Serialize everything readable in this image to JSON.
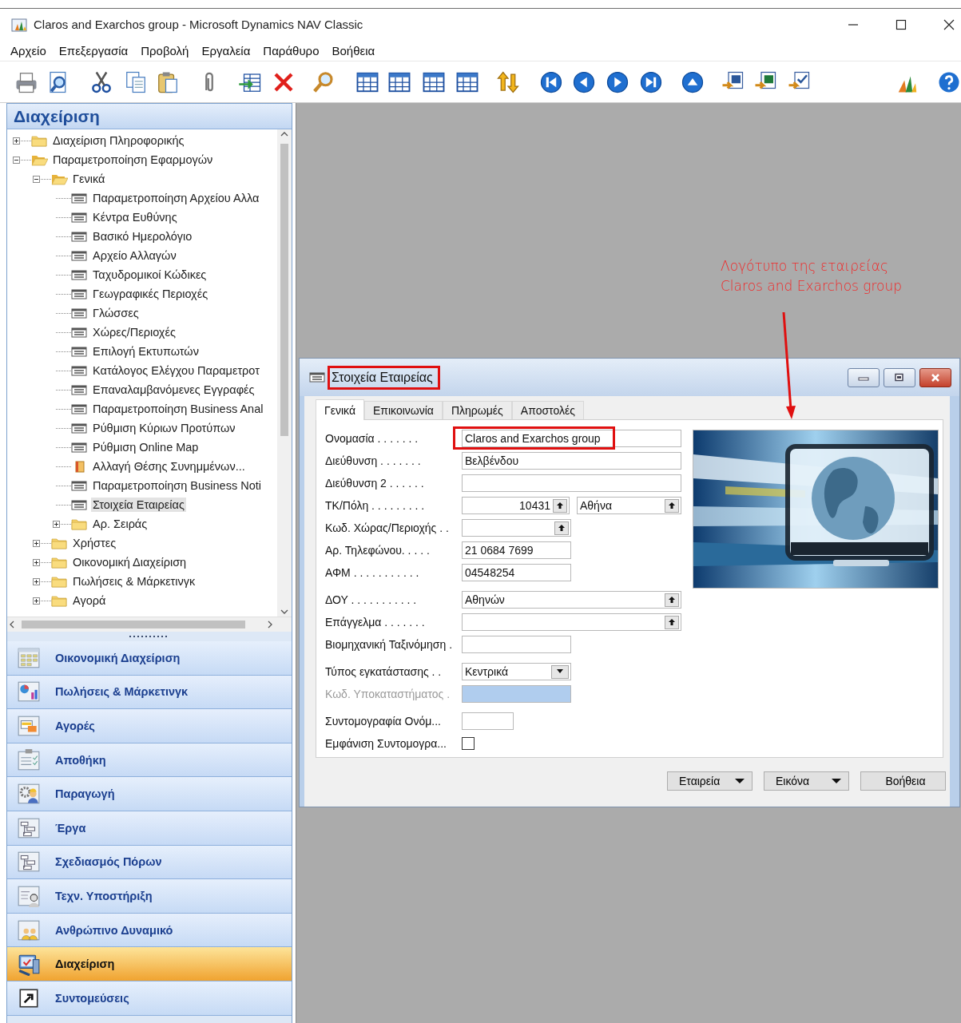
{
  "window": {
    "title": "Claros and Exarchos group - Microsoft Dynamics NAV Classic"
  },
  "menu": [
    "Αρχείο",
    "Επεξεργασία",
    "Προβολή",
    "Εργαλεία",
    "Παράθυρο",
    "Βοήθεια"
  ],
  "navigation_pane": {
    "title": "Διαχείριση",
    "tree": [
      {
        "label": "Διαχείριση Πληροφορικής",
        "kind": "folder",
        "expanded": false,
        "selected": false
      },
      {
        "label": "Παραμετροποίηση Εφαρμογών",
        "kind": "folder",
        "expanded": true,
        "selected": false,
        "children": [
          {
            "label": "Γενικά",
            "kind": "folder",
            "expanded": true,
            "selected": false,
            "children": [
              {
                "label": "Παραμετροποίηση Αρχείου Αλλα",
                "kind": "form",
                "selected": false
              },
              {
                "label": "Κέντρα Ευθύνης",
                "kind": "form",
                "selected": false
              },
              {
                "label": "Βασικό Ημερολόγιο",
                "kind": "form",
                "selected": false
              },
              {
                "label": "Αρχείο Αλλαγών",
                "kind": "form",
                "selected": false
              },
              {
                "label": "Ταχυδρομικοί Κώδικες",
                "kind": "form",
                "selected": false
              },
              {
                "label": "Γεωγραφικές Περιοχές",
                "kind": "form",
                "selected": false
              },
              {
                "label": "Γλώσσες",
                "kind": "form",
                "selected": false
              },
              {
                "label": "Χώρες/Περιοχές",
                "kind": "form",
                "selected": false
              },
              {
                "label": "Επιλογή Εκτυπωτών",
                "kind": "form",
                "selected": false
              },
              {
                "label": "Κατάλογος Ελέγχου Παραμετροτ",
                "kind": "form",
                "selected": false
              },
              {
                "label": "Επαναλαμβανόμενες Εγγραφές",
                "kind": "form",
                "selected": false
              },
              {
                "label": "Παραμετροποίηση Business Anal",
                "kind": "form",
                "selected": false
              },
              {
                "label": "Ρύθμιση Κύριων Προτύπων",
                "kind": "form",
                "selected": false
              },
              {
                "label": "Ρύθμιση Online Map",
                "kind": "form",
                "selected": false
              },
              {
                "label": "Αλλαγή Θέσης Συνημμένων...",
                "kind": "batch",
                "selected": false
              },
              {
                "label": "Παραμετροποίηση Business Noti",
                "kind": "form",
                "selected": false
              },
              {
                "label": "Στοιχεία Εταιρείας",
                "kind": "form",
                "selected": true
              },
              {
                "label": "Αρ. Σειράς",
                "kind": "folder",
                "expanded": false,
                "selected": false
              }
            ]
          },
          {
            "label": "Χρήστες",
            "kind": "folder",
            "expanded": false,
            "selected": false
          },
          {
            "label": "Οικονομική Διαχείριση",
            "kind": "folder",
            "expanded": false,
            "selected": false
          },
          {
            "label": "Πωλήσεις & Μάρκετινγκ",
            "kind": "folder",
            "expanded": false,
            "selected": false
          },
          {
            "label": "Αγορά",
            "kind": "folder",
            "expanded": false,
            "selected": false
          }
        ]
      }
    ],
    "buttons": [
      {
        "label": "Οικονομική Διαχείριση",
        "selected": false
      },
      {
        "label": "Πωλήσεις & Μάρκετινγκ",
        "selected": false
      },
      {
        "label": "Αγορές",
        "selected": false
      },
      {
        "label": "Αποθήκη",
        "selected": false
      },
      {
        "label": "Παραγωγή",
        "selected": false
      },
      {
        "label": "Έργα",
        "selected": false
      },
      {
        "label": "Σχεδιασμός Πόρων",
        "selected": false
      },
      {
        "label": "Τεχν. Υποστήριξη",
        "selected": false
      },
      {
        "label": "Ανθρώπινο Δυναμικό",
        "selected": false
      },
      {
        "label": "Διαχείριση",
        "selected": true
      },
      {
        "label": "Συντομεύσεις",
        "selected": false
      }
    ]
  },
  "annotation": {
    "lines": [
      "Λογότυπο της εταιρείας",
      "Claros and Exarchos group"
    ]
  },
  "company_window": {
    "title": "Στοιχεία Εταιρείας",
    "title_highlighted": true,
    "tabs": [
      {
        "label": "Γενικά",
        "selected": true
      },
      {
        "label": "Επικοινωνία",
        "selected": false
      },
      {
        "label": "Πληρωμές",
        "selected": false
      },
      {
        "label": "Αποστολές",
        "selected": false
      }
    ],
    "field_groups": [
      [
        {
          "label": "Ονομασία . . . . . . .",
          "kind": "text",
          "value": "Claros and Exarchos group",
          "highlighted": true,
          "disabled": false
        },
        {
          "label": "Διεύθυνση . . . . . . .",
          "kind": "text",
          "value": "Βελβένδου",
          "highlighted": false,
          "disabled": false
        },
        {
          "label": "Διεύθυνση 2 . . . . . .",
          "kind": "text",
          "highlighted": false,
          "disabled": false
        },
        {
          "label": "ΤΚ/Πόλη . . . . . . . . .",
          "kind": "lookup_pair",
          "value": "10431",
          "value_2": "Αθήνα",
          "highlighted": false,
          "disabled": false
        },
        {
          "label": "Κωδ. Χώρας/Περιοχής . .",
          "kind": "lookup",
          "highlighted": false,
          "disabled": false
        },
        {
          "label": "Αρ. Τηλεφώνου. . . . .",
          "kind": "text",
          "value": "21 0684 7699",
          "highlighted": false,
          "disabled": false
        },
        {
          "label": "ΑΦΜ . . . . . . . . . . .",
          "kind": "text",
          "value": "04548254",
          "highlighted": false,
          "disabled": false
        }
      ],
      [
        {
          "label": "ΔΟΥ . . . . . . . . . . .",
          "kind": "lookup",
          "value": "Αθηνών",
          "highlighted": false,
          "disabled": false
        },
        {
          "label": "Επάγγελμα . . . . . . .",
          "kind": "lookup",
          "highlighted": false,
          "disabled": false
        },
        {
          "label": "Βιομηχανική Ταξινόμηση .",
          "kind": "text",
          "highlighted": false,
          "disabled": false
        }
      ],
      [
        {
          "label": "Τύπος εγκατάστασης  . .",
          "kind": "dropdown",
          "value": "Κεντρικά",
          "highlighted": false,
          "disabled": false
        },
        {
          "label": "Κωδ. Υποκαταστήματος .",
          "kind": "text",
          "highlighted": false,
          "disabled": true
        }
      ],
      [
        {
          "label": "Συντομογραφία Ονόμ...",
          "kind": "text",
          "highlighted": false,
          "disabled": false
        },
        {
          "label": "Εμφάνιση Συντομογρα...",
          "kind": "checkbox",
          "checked": false,
          "highlighted": false,
          "disabled": false
        }
      ]
    ],
    "picture": {
      "kind": "picture"
    },
    "buttons": [
      {
        "label": "Εταιρεία",
        "kind": "menu"
      },
      {
        "label": "Εικόνα",
        "kind": "menu"
      },
      {
        "label": "Βοήθεια",
        "kind": "plain"
      }
    ]
  }
}
